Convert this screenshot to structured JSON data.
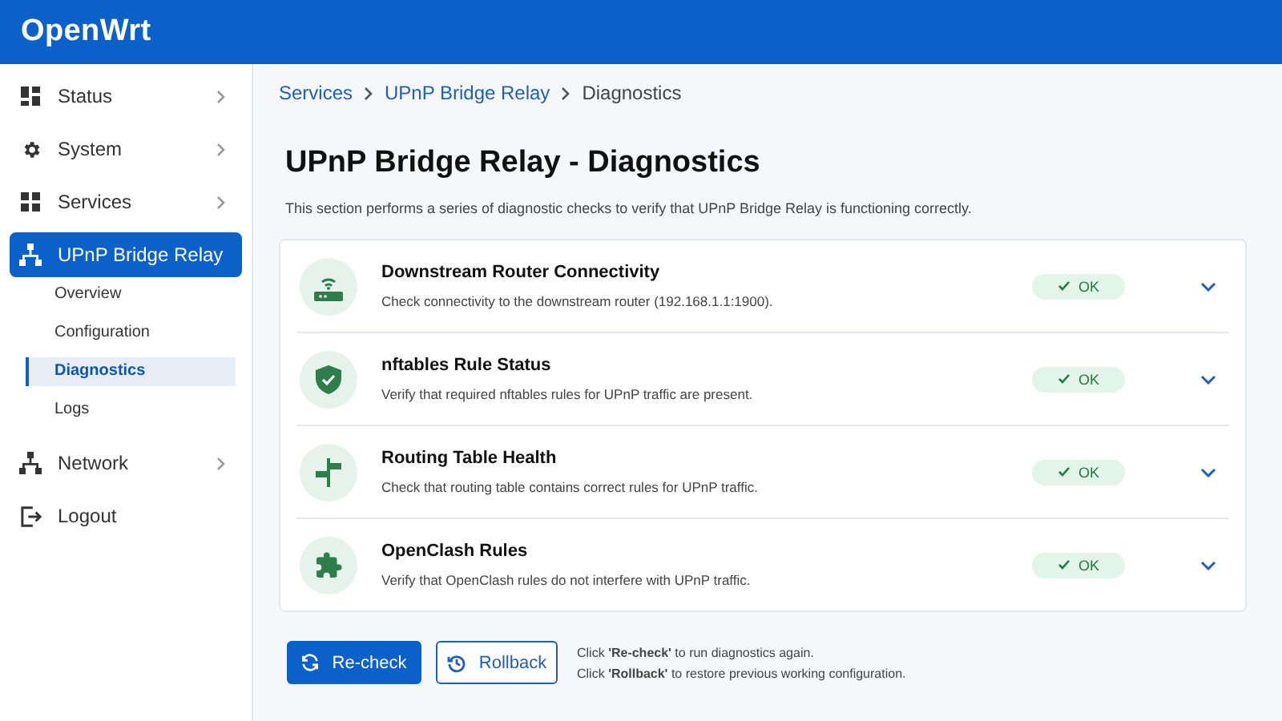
{
  "header": {
    "brand": "OpenWrt"
  },
  "sidebar": {
    "items": [
      {
        "label": "Status",
        "selected": false,
        "has_arrow": true
      },
      {
        "label": "System",
        "selected": false,
        "has_arrow": true
      },
      {
        "label": "Services",
        "selected": false,
        "has_arrow": true
      },
      {
        "label": "UPnP Bridge Relay",
        "selected": true,
        "has_arrow": false,
        "children": [
          {
            "label": "Overview",
            "selected": false
          },
          {
            "label": "Configuration",
            "selected": false
          },
          {
            "label": "Diagnostics",
            "selected": true
          },
          {
            "label": "Logs",
            "selected": false
          }
        ]
      },
      {
        "label": "Network",
        "selected": false,
        "has_arrow": true
      },
      {
        "label": "Logout",
        "selected": false,
        "has_arrow": false
      }
    ]
  },
  "breadcrumb": [
    {
      "label": "Services",
      "link": true
    },
    {
      "label": "UPnP Bridge Relay",
      "link": true
    },
    {
      "label": "Diagnostics",
      "link": false
    }
  ],
  "page": {
    "title": "UPnP Bridge Relay - Diagnostics",
    "description": "This section performs a series of diagnostic checks to verify that UPnP Bridge Relay is functioning correctly."
  },
  "checks": [
    {
      "title": "Downstream Router Connectivity",
      "description": "Check connectivity to the downstream router (192.168.1.1:1900).",
      "status": "OK",
      "expanded": false
    },
    {
      "title": "nftables Rule Status",
      "description": "Verify that required nftables rules for UPnP traffic are present.",
      "status": "OK",
      "expanded": false
    },
    {
      "title": "Routing Table Health",
      "description": "Check that routing table contains correct rules for UPnP traffic.",
      "status": "OK",
      "expanded": false
    },
    {
      "title": "OpenClash Rules",
      "description": "Verify that OpenClash rules do not interfere with UPnP traffic.",
      "status": "OK",
      "expanded": false
    }
  ],
  "actions": {
    "buttons": [
      {
        "label": "Re-check",
        "kind": "primary"
      },
      {
        "label": "Rollback",
        "kind": "secondary"
      }
    ],
    "hints": [
      "Click **'Re-check'** to run diagnostics again.",
      "Click **'Rollback'** to restore previous working configuration."
    ]
  }
}
